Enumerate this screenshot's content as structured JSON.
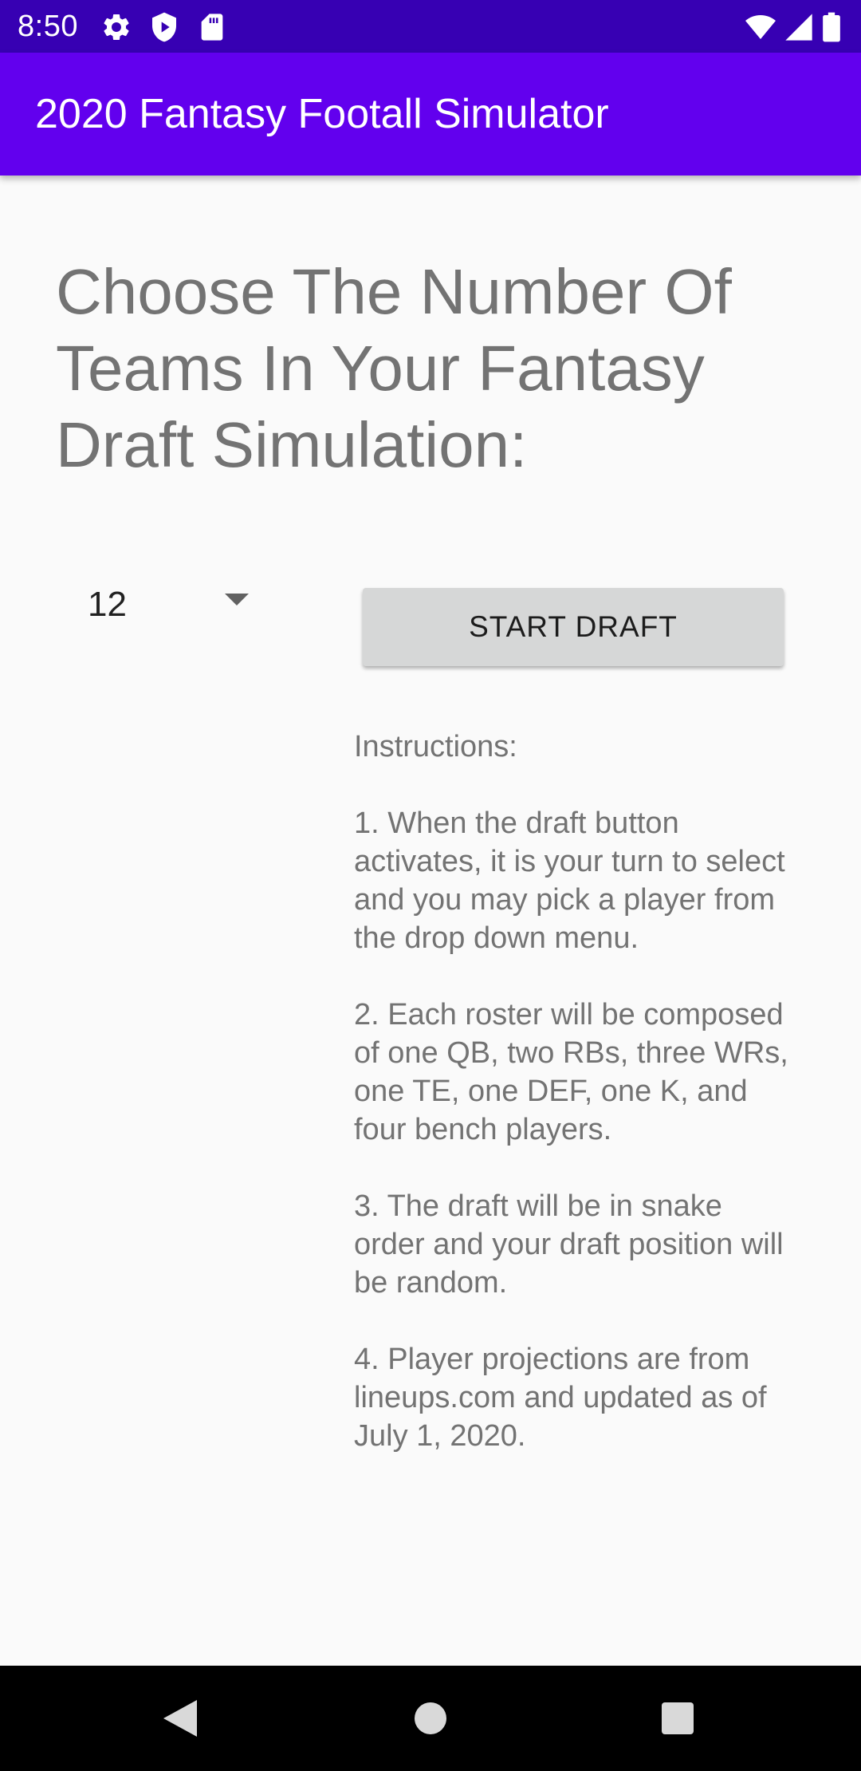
{
  "status_bar": {
    "time": "8:50",
    "icons_left": [
      "gear-icon",
      "shield-play-icon",
      "sd-card-icon"
    ],
    "icons_right": [
      "wifi-icon",
      "cell-signal-icon",
      "battery-icon"
    ]
  },
  "app_bar": {
    "title": "2020 Fantasy Footall Simulator",
    "color": "#6200ee"
  },
  "main": {
    "heading": "Choose The Number Of Teams In Your Fantasy Draft Simulation:",
    "team_count": {
      "selected": "12"
    },
    "start_button": {
      "label": "START DRAFT"
    },
    "instructions": {
      "title": "Instructions:",
      "items": [
        "1. When the draft button activates, it is your turn to select and you may pick a player from the drop down menu.",
        "2. Each roster will be composed of one QB, two RBs, three WRs, one TE, one DEF, one K, and four bench players.",
        "3. The draft will be in snake order and your draft position will be random.",
        "4. Player projections are from lineups.com and updated as of July 1, 2020."
      ]
    }
  },
  "nav_bar": {
    "icons": [
      "back-icon",
      "home-icon",
      "recents-icon"
    ]
  }
}
